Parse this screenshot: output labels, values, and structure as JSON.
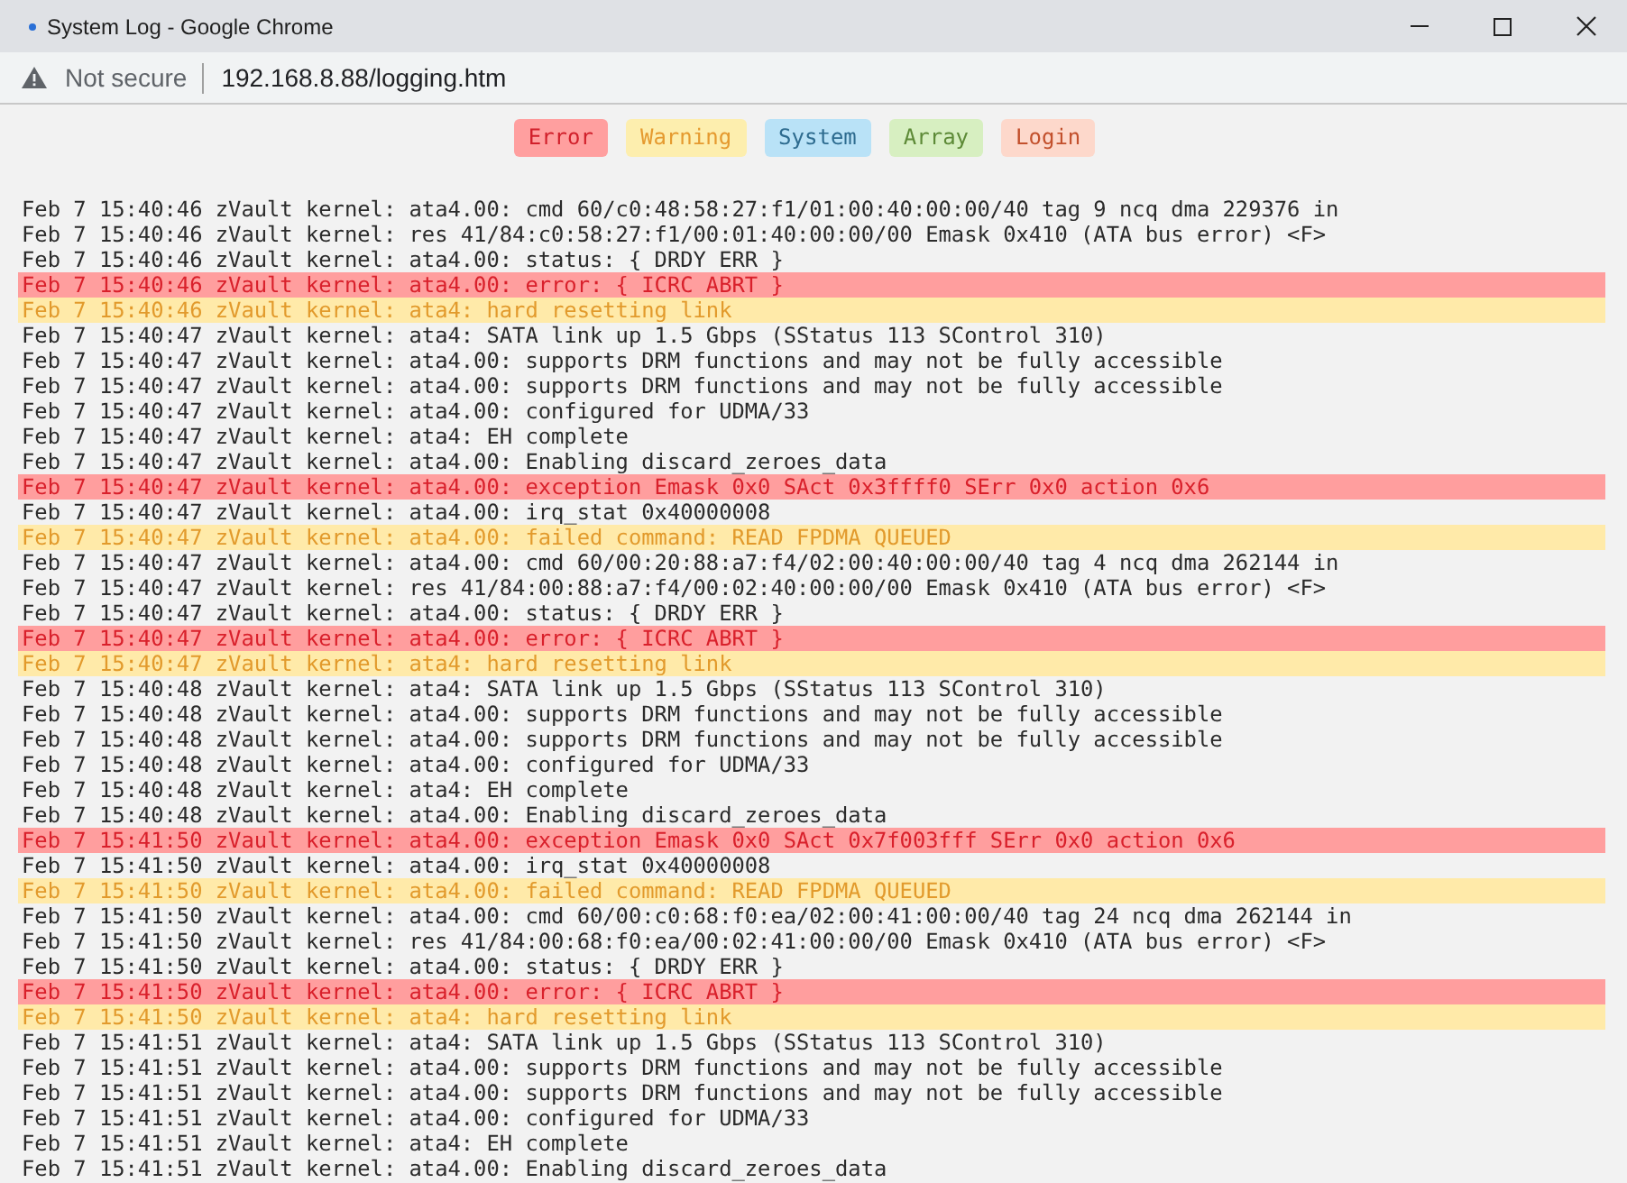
{
  "window": {
    "title": "System Log - Google Chrome"
  },
  "address_bar": {
    "security": "Not secure",
    "url": "192.168.8.88/logging.htm"
  },
  "filters": [
    {
      "label": "Error",
      "kind": "error"
    },
    {
      "label": "Warning",
      "kind": "warning"
    },
    {
      "label": "System",
      "kind": "system"
    },
    {
      "label": "Array",
      "kind": "array"
    },
    {
      "label": "Login",
      "kind": "login"
    }
  ],
  "log": [
    {
      "text": "Feb 7 15:40:46 zVault kernel: ata4.00: cmd 60/c0:48:58:27:f1/01:00:40:00:00/40 tag 9 ncq dma 229376 in",
      "kind": "plain"
    },
    {
      "text": "Feb 7 15:40:46 zVault kernel: res 41/84:c0:58:27:f1/00:01:40:00:00/00 Emask 0x410 (ATA bus error) <F>",
      "kind": "plain"
    },
    {
      "text": "Feb 7 15:40:46 zVault kernel: ata4.00: status: { DRDY ERR }",
      "kind": "plain"
    },
    {
      "text": "Feb 7 15:40:46 zVault kernel: ata4.00: error: { ICRC ABRT }",
      "kind": "error"
    },
    {
      "text": "Feb 7 15:40:46 zVault kernel: ata4: hard resetting link",
      "kind": "warning"
    },
    {
      "text": "Feb 7 15:40:47 zVault kernel: ata4: SATA link up 1.5 Gbps (SStatus 113 SControl 310)",
      "kind": "plain"
    },
    {
      "text": "Feb 7 15:40:47 zVault kernel: ata4.00: supports DRM functions and may not be fully accessible",
      "kind": "plain"
    },
    {
      "text": "Feb 7 15:40:47 zVault kernel: ata4.00: supports DRM functions and may not be fully accessible",
      "kind": "plain"
    },
    {
      "text": "Feb 7 15:40:47 zVault kernel: ata4.00: configured for UDMA/33",
      "kind": "plain"
    },
    {
      "text": "Feb 7 15:40:47 zVault kernel: ata4: EH complete",
      "kind": "plain"
    },
    {
      "text": "Feb 7 15:40:47 zVault kernel: ata4.00: Enabling discard_zeroes_data",
      "kind": "plain"
    },
    {
      "text": "Feb 7 15:40:47 zVault kernel: ata4.00: exception Emask 0x0 SAct 0x3ffff0 SErr 0x0 action 0x6",
      "kind": "error"
    },
    {
      "text": "Feb 7 15:40:47 zVault kernel: ata4.00: irq_stat 0x40000008",
      "kind": "plain"
    },
    {
      "text": "Feb 7 15:40:47 zVault kernel: ata4.00: failed command: READ FPDMA QUEUED",
      "kind": "warning"
    },
    {
      "text": "Feb 7 15:40:47 zVault kernel: ata4.00: cmd 60/00:20:88:a7:f4/02:00:40:00:00/40 tag 4 ncq dma 262144 in",
      "kind": "plain"
    },
    {
      "text": "Feb 7 15:40:47 zVault kernel: res 41/84:00:88:a7:f4/00:02:40:00:00/00 Emask 0x410 (ATA bus error) <F>",
      "kind": "plain"
    },
    {
      "text": "Feb 7 15:40:47 zVault kernel: ata4.00: status: { DRDY ERR }",
      "kind": "plain"
    },
    {
      "text": "Feb 7 15:40:47 zVault kernel: ata4.00: error: { ICRC ABRT }",
      "kind": "error"
    },
    {
      "text": "Feb 7 15:40:47 zVault kernel: ata4: hard resetting link",
      "kind": "warning"
    },
    {
      "text": "Feb 7 15:40:48 zVault kernel: ata4: SATA link up 1.5 Gbps (SStatus 113 SControl 310)",
      "kind": "plain"
    },
    {
      "text": "Feb 7 15:40:48 zVault kernel: ata4.00: supports DRM functions and may not be fully accessible",
      "kind": "plain"
    },
    {
      "text": "Feb 7 15:40:48 zVault kernel: ata4.00: supports DRM functions and may not be fully accessible",
      "kind": "plain"
    },
    {
      "text": "Feb 7 15:40:48 zVault kernel: ata4.00: configured for UDMA/33",
      "kind": "plain"
    },
    {
      "text": "Feb 7 15:40:48 zVault kernel: ata4: EH complete",
      "kind": "plain"
    },
    {
      "text": "Feb 7 15:40:48 zVault kernel: ata4.00: Enabling discard_zeroes_data",
      "kind": "plain"
    },
    {
      "text": "Feb 7 15:41:50 zVault kernel: ata4.00: exception Emask 0x0 SAct 0x7f003fff SErr 0x0 action 0x6",
      "kind": "error"
    },
    {
      "text": "Feb 7 15:41:50 zVault kernel: ata4.00: irq_stat 0x40000008",
      "kind": "plain"
    },
    {
      "text": "Feb 7 15:41:50 zVault kernel: ata4.00: failed command: READ FPDMA QUEUED",
      "kind": "warning"
    },
    {
      "text": "Feb 7 15:41:50 zVault kernel: ata4.00: cmd 60/00:c0:68:f0:ea/02:00:41:00:00/40 tag 24 ncq dma 262144 in",
      "kind": "plain"
    },
    {
      "text": "Feb 7 15:41:50 zVault kernel: res 41/84:00:68:f0:ea/00:02:41:00:00/00 Emask 0x410 (ATA bus error) <F>",
      "kind": "plain"
    },
    {
      "text": "Feb 7 15:41:50 zVault kernel: ata4.00: status: { DRDY ERR }",
      "kind": "plain"
    },
    {
      "text": "Feb 7 15:41:50 zVault kernel: ata4.00: error: { ICRC ABRT }",
      "kind": "error"
    },
    {
      "text": "Feb 7 15:41:50 zVault kernel: ata4: hard resetting link",
      "kind": "warning"
    },
    {
      "text": "Feb 7 15:41:51 zVault kernel: ata4: SATA link up 1.5 Gbps (SStatus 113 SControl 310)",
      "kind": "plain"
    },
    {
      "text": "Feb 7 15:41:51 zVault kernel: ata4.00: supports DRM functions and may not be fully accessible",
      "kind": "plain"
    },
    {
      "text": "Feb 7 15:41:51 zVault kernel: ata4.00: supports DRM functions and may not be fully accessible",
      "kind": "plain"
    },
    {
      "text": "Feb 7 15:41:51 zVault kernel: ata4.00: configured for UDMA/33",
      "kind": "plain"
    },
    {
      "text": "Feb 7 15:41:51 zVault kernel: ata4: EH complete",
      "kind": "plain"
    },
    {
      "text": "Feb 7 15:41:51 zVault kernel: ata4.00: Enabling discard_zeroes_data",
      "kind": "plain"
    }
  ]
}
